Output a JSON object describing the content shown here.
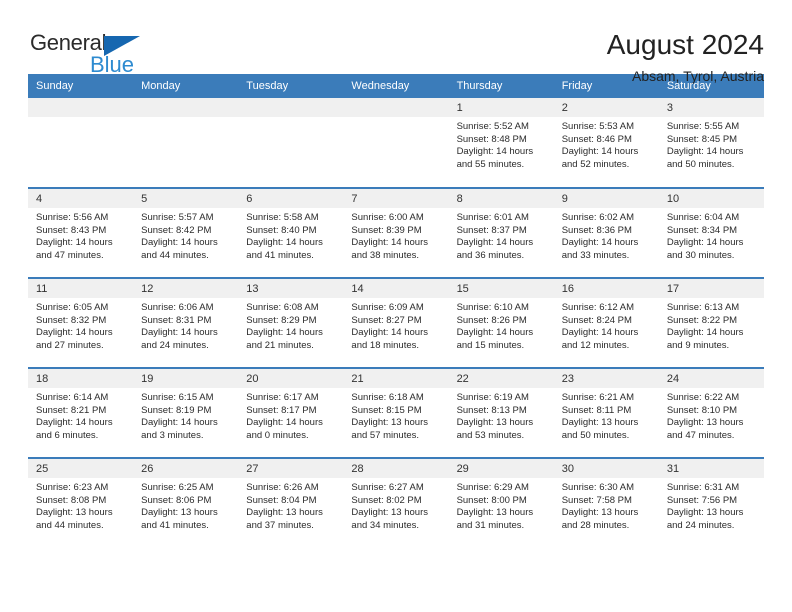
{
  "logo": {
    "word_one": "General",
    "word_two": "Blue",
    "triangle_color": "#1667b0",
    "blue_color": "#2e8bd0"
  },
  "header": {
    "title": "August 2024",
    "subtitle": "Absam, Tyrol, Austria",
    "header_bg": "#3b7cba",
    "daynum_bg": "#f0f0f0"
  },
  "weekday_headers": [
    "Sunday",
    "Monday",
    "Tuesday",
    "Wednesday",
    "Thursday",
    "Friday",
    "Saturday"
  ],
  "labels": {
    "sunrise": "Sunrise:",
    "sunset": "Sunset:",
    "daylight": "Daylight:"
  },
  "weeks": [
    [
      {
        "day": "",
        "l1": "",
        "l2": "",
        "l3": "",
        "l4": ""
      },
      {
        "day": "",
        "l1": "",
        "l2": "",
        "l3": "",
        "l4": ""
      },
      {
        "day": "",
        "l1": "",
        "l2": "",
        "l3": "",
        "l4": ""
      },
      {
        "day": "",
        "l1": "",
        "l2": "",
        "l3": "",
        "l4": ""
      },
      {
        "day": "1",
        "l1": "Sunrise: 5:52 AM",
        "l2": "Sunset: 8:48 PM",
        "l3": "Daylight: 14 hours",
        "l4": "and 55 minutes."
      },
      {
        "day": "2",
        "l1": "Sunrise: 5:53 AM",
        "l2": "Sunset: 8:46 PM",
        "l3": "Daylight: 14 hours",
        "l4": "and 52 minutes."
      },
      {
        "day": "3",
        "l1": "Sunrise: 5:55 AM",
        "l2": "Sunset: 8:45 PM",
        "l3": "Daylight: 14 hours",
        "l4": "and 50 minutes."
      }
    ],
    [
      {
        "day": "4",
        "l1": "Sunrise: 5:56 AM",
        "l2": "Sunset: 8:43 PM",
        "l3": "Daylight: 14 hours",
        "l4": "and 47 minutes."
      },
      {
        "day": "5",
        "l1": "Sunrise: 5:57 AM",
        "l2": "Sunset: 8:42 PM",
        "l3": "Daylight: 14 hours",
        "l4": "and 44 minutes."
      },
      {
        "day": "6",
        "l1": "Sunrise: 5:58 AM",
        "l2": "Sunset: 8:40 PM",
        "l3": "Daylight: 14 hours",
        "l4": "and 41 minutes."
      },
      {
        "day": "7",
        "l1": "Sunrise: 6:00 AM",
        "l2": "Sunset: 8:39 PM",
        "l3": "Daylight: 14 hours",
        "l4": "and 38 minutes."
      },
      {
        "day": "8",
        "l1": "Sunrise: 6:01 AM",
        "l2": "Sunset: 8:37 PM",
        "l3": "Daylight: 14 hours",
        "l4": "and 36 minutes."
      },
      {
        "day": "9",
        "l1": "Sunrise: 6:02 AM",
        "l2": "Sunset: 8:36 PM",
        "l3": "Daylight: 14 hours",
        "l4": "and 33 minutes."
      },
      {
        "day": "10",
        "l1": "Sunrise: 6:04 AM",
        "l2": "Sunset: 8:34 PM",
        "l3": "Daylight: 14 hours",
        "l4": "and 30 minutes."
      }
    ],
    [
      {
        "day": "11",
        "l1": "Sunrise: 6:05 AM",
        "l2": "Sunset: 8:32 PM",
        "l3": "Daylight: 14 hours",
        "l4": "and 27 minutes."
      },
      {
        "day": "12",
        "l1": "Sunrise: 6:06 AM",
        "l2": "Sunset: 8:31 PM",
        "l3": "Daylight: 14 hours",
        "l4": "and 24 minutes."
      },
      {
        "day": "13",
        "l1": "Sunrise: 6:08 AM",
        "l2": "Sunset: 8:29 PM",
        "l3": "Daylight: 14 hours",
        "l4": "and 21 minutes."
      },
      {
        "day": "14",
        "l1": "Sunrise: 6:09 AM",
        "l2": "Sunset: 8:27 PM",
        "l3": "Daylight: 14 hours",
        "l4": "and 18 minutes."
      },
      {
        "day": "15",
        "l1": "Sunrise: 6:10 AM",
        "l2": "Sunset: 8:26 PM",
        "l3": "Daylight: 14 hours",
        "l4": "and 15 minutes."
      },
      {
        "day": "16",
        "l1": "Sunrise: 6:12 AM",
        "l2": "Sunset: 8:24 PM",
        "l3": "Daylight: 14 hours",
        "l4": "and 12 minutes."
      },
      {
        "day": "17",
        "l1": "Sunrise: 6:13 AM",
        "l2": "Sunset: 8:22 PM",
        "l3": "Daylight: 14 hours",
        "l4": "and 9 minutes."
      }
    ],
    [
      {
        "day": "18",
        "l1": "Sunrise: 6:14 AM",
        "l2": "Sunset: 8:21 PM",
        "l3": "Daylight: 14 hours",
        "l4": "and 6 minutes."
      },
      {
        "day": "19",
        "l1": "Sunrise: 6:15 AM",
        "l2": "Sunset: 8:19 PM",
        "l3": "Daylight: 14 hours",
        "l4": "and 3 minutes."
      },
      {
        "day": "20",
        "l1": "Sunrise: 6:17 AM",
        "l2": "Sunset: 8:17 PM",
        "l3": "Daylight: 14 hours",
        "l4": "and 0 minutes."
      },
      {
        "day": "21",
        "l1": "Sunrise: 6:18 AM",
        "l2": "Sunset: 8:15 PM",
        "l3": "Daylight: 13 hours",
        "l4": "and 57 minutes."
      },
      {
        "day": "22",
        "l1": "Sunrise: 6:19 AM",
        "l2": "Sunset: 8:13 PM",
        "l3": "Daylight: 13 hours",
        "l4": "and 53 minutes."
      },
      {
        "day": "23",
        "l1": "Sunrise: 6:21 AM",
        "l2": "Sunset: 8:11 PM",
        "l3": "Daylight: 13 hours",
        "l4": "and 50 minutes."
      },
      {
        "day": "24",
        "l1": "Sunrise: 6:22 AM",
        "l2": "Sunset: 8:10 PM",
        "l3": "Daylight: 13 hours",
        "l4": "and 47 minutes."
      }
    ],
    [
      {
        "day": "25",
        "l1": "Sunrise: 6:23 AM",
        "l2": "Sunset: 8:08 PM",
        "l3": "Daylight: 13 hours",
        "l4": "and 44 minutes."
      },
      {
        "day": "26",
        "l1": "Sunrise: 6:25 AM",
        "l2": "Sunset: 8:06 PM",
        "l3": "Daylight: 13 hours",
        "l4": "and 41 minutes."
      },
      {
        "day": "27",
        "l1": "Sunrise: 6:26 AM",
        "l2": "Sunset: 8:04 PM",
        "l3": "Daylight: 13 hours",
        "l4": "and 37 minutes."
      },
      {
        "day": "28",
        "l1": "Sunrise: 6:27 AM",
        "l2": "Sunset: 8:02 PM",
        "l3": "Daylight: 13 hours",
        "l4": "and 34 minutes."
      },
      {
        "day": "29",
        "l1": "Sunrise: 6:29 AM",
        "l2": "Sunset: 8:00 PM",
        "l3": "Daylight: 13 hours",
        "l4": "and 31 minutes."
      },
      {
        "day": "30",
        "l1": "Sunrise: 6:30 AM",
        "l2": "Sunset: 7:58 PM",
        "l3": "Daylight: 13 hours",
        "l4": "and 28 minutes."
      },
      {
        "day": "31",
        "l1": "Sunrise: 6:31 AM",
        "l2": "Sunset: 7:56 PM",
        "l3": "Daylight: 13 hours",
        "l4": "and 24 minutes."
      }
    ]
  ]
}
